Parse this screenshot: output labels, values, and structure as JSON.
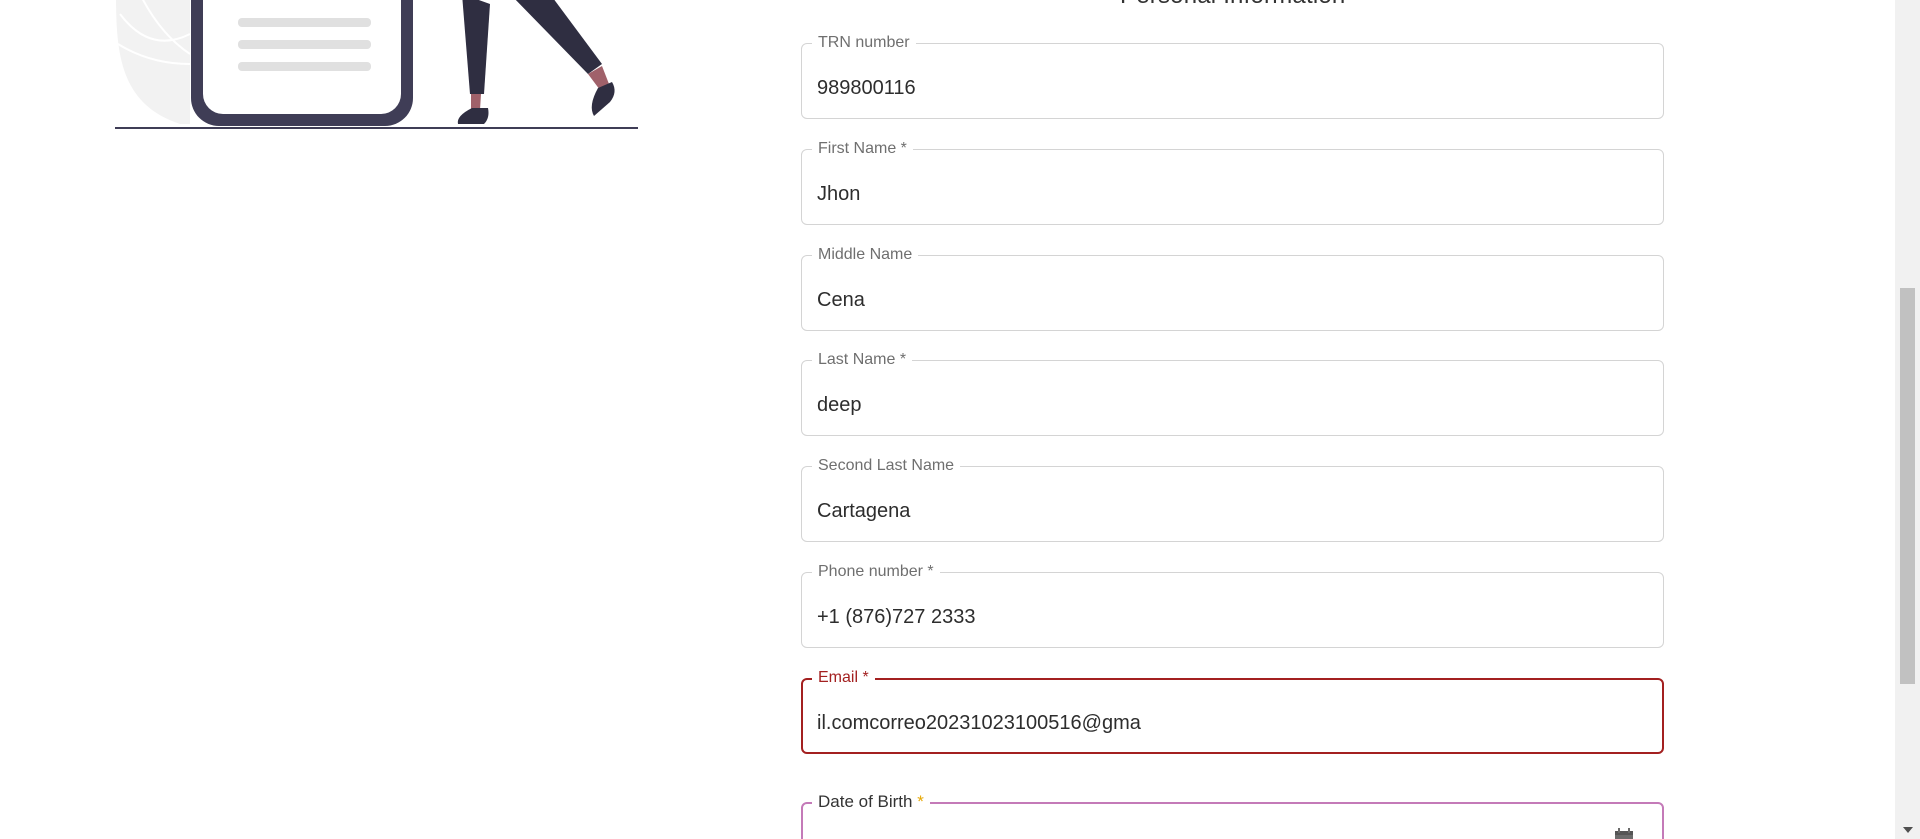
{
  "section": {
    "title": "Personal Information"
  },
  "form": {
    "trn": {
      "label": "TRN number",
      "value": "989800116"
    },
    "first_name": {
      "label": "First Name *",
      "value": "Jhon"
    },
    "middle_name": {
      "label": "Middle Name",
      "value": "Cena"
    },
    "last_name": {
      "label": "Last Name *",
      "value": "deep"
    },
    "second_last_name": {
      "label": "Second Last Name",
      "value": "Cartagena"
    },
    "phone": {
      "label": "Phone number *",
      "value": "+1 (876)727 2333"
    },
    "email": {
      "label": "Email *",
      "value": "il.comcorreo20231023100516@gma"
    },
    "dob": {
      "label": "Date of Birth",
      "required_mark": "*"
    }
  },
  "colors": {
    "error": "#a32020",
    "focus_accent": "#c47ab8",
    "required_star": "#e6a700",
    "border": "#d4d4d4",
    "illustration_dark": "#3f3d56"
  },
  "icons": {
    "calendar": "calendar-icon"
  }
}
